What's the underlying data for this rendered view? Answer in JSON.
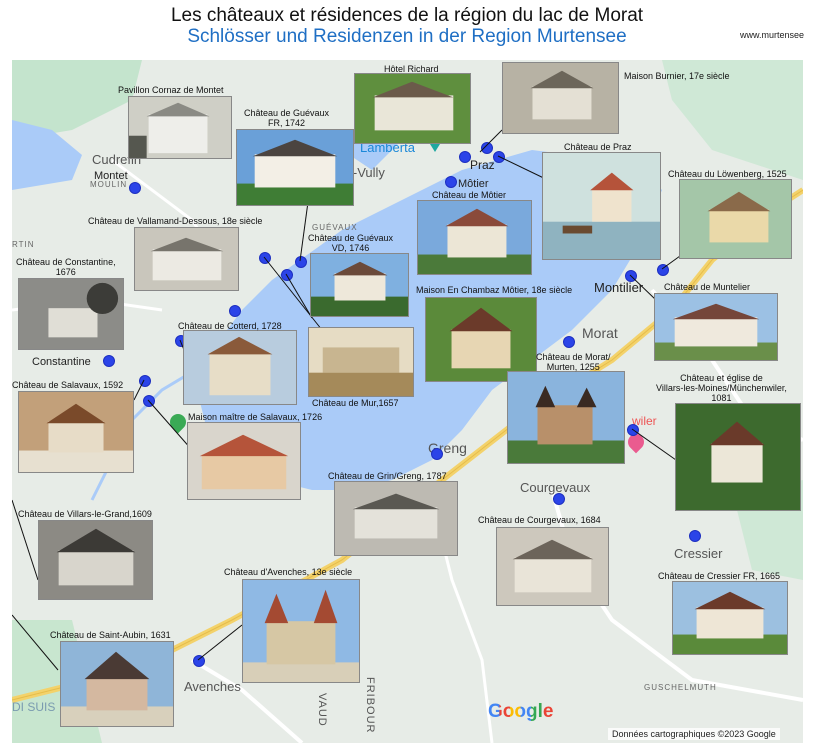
{
  "header": {
    "title_fr": "Les châteaux et résidences de la région du lac de Morat",
    "title_de": "Schlösser und Residenzen in der Region Murtensee",
    "website": "www.murtensee"
  },
  "map": {
    "places": {
      "cudrefin": "Cudrefin",
      "montet": "Montet",
      "moulin": "MOULIN",
      "lamberta": "Lamberta",
      "praz": "Praz",
      "mont_vully": "Mont-Vully",
      "motier": "Môtier",
      "guevaux": "GUÉVAUX",
      "rtin": "RTIN",
      "montilier": "Montilier",
      "morat": "Morat",
      "constantine": "Constantine",
      "greng": "Greng",
      "courgevaux": "Courgevaux",
      "cressier": "Cressier",
      "avenches": "Avenches",
      "guschelmuth": "GUSCHELMUTH",
      "disuis": "DI SUIS",
      "vaud": "VAUD",
      "fribour": "FRIBOUR",
      "wiler": "wiler"
    },
    "google_logo": "Google",
    "copyright": "Données cartographiques ©2023 Google",
    "colors": {
      "water": "#aacbf8",
      "land": "#e7ece7",
      "green": "#c4e4cd",
      "road": "#f3d26b",
      "pin": "#2b44e8"
    }
  },
  "castles": [
    {
      "id": "pavillon-cornaz",
      "label": "Pavillon Cornaz de Montet"
    },
    {
      "id": "hotel-richard",
      "label": "Hôtel Richard"
    },
    {
      "id": "maison-burnier",
      "label": "Maison Burnier, 17e siècle"
    },
    {
      "id": "guevaux-fr",
      "label": "Château de Guévaux\nFR, 1742"
    },
    {
      "id": "praz",
      "label": "Château de Praz"
    },
    {
      "id": "motier",
      "label": "Château de Môtier"
    },
    {
      "id": "lowenberg",
      "label": "Château du Löwenberg, 1525"
    },
    {
      "id": "vallamand",
      "label": "Château de Vallamand-Dessous, 18e siècle"
    },
    {
      "id": "guevaux-vd",
      "label": "Château de Guévaux\nVD, 1746"
    },
    {
      "id": "constantine",
      "label": "Château de Constantine,\n1676"
    },
    {
      "id": "en-chambaz",
      "label": "Maison En Chambaz Môtier, 18e siècle"
    },
    {
      "id": "muntelier",
      "label": "Château de Muntelier"
    },
    {
      "id": "cotterd",
      "label": "Château de Cotterd, 1728"
    },
    {
      "id": "morat",
      "label": "Château de Morat/\nMurten, 1255"
    },
    {
      "id": "salavaux",
      "label": "Château de Salavaux, 1592"
    },
    {
      "id": "mur",
      "label": "Château de Mur,1657"
    },
    {
      "id": "maison-salavaux",
      "label": "Maison maître de Salavaux, 1726"
    },
    {
      "id": "villars-moines",
      "label": "Château et église de\nVillars-les-Moines/Münchenwiler,\n1081"
    },
    {
      "id": "grin",
      "label": "Château de Grin/Greng, 1787"
    },
    {
      "id": "villars-grand",
      "label": "Château de Villars-le-Grand,1609"
    },
    {
      "id": "courgevaux",
      "label": "Château de Courgevaux, 1684"
    },
    {
      "id": "avenches",
      "label": "Château d'Avenches, 13e siècle"
    },
    {
      "id": "cressier",
      "label": "Château de Cressier FR, 1665"
    },
    {
      "id": "saint-aubin",
      "label": "Château de Saint-Aubin, 1631"
    }
  ]
}
